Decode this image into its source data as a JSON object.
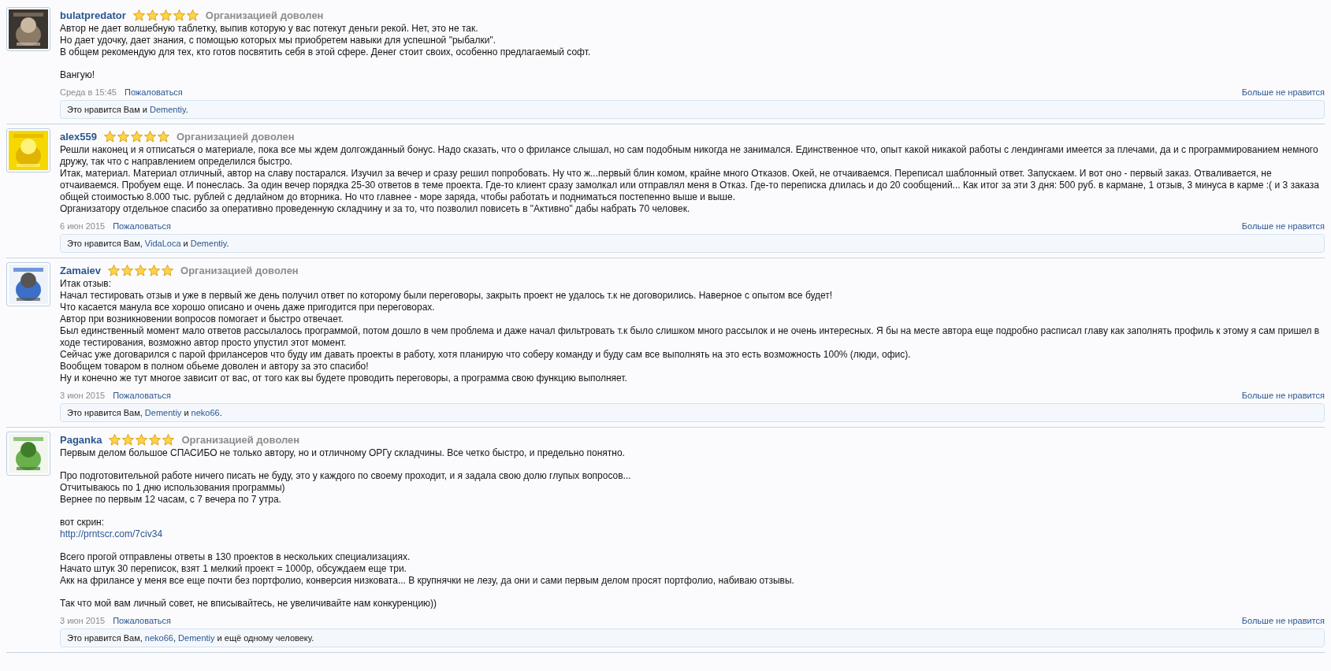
{
  "reviews": [
    {
      "author": "bulatpredator",
      "stars": 5,
      "rating": "Организацией доволен",
      "body": [
        [
          {
            "kind": "text",
            "text": "Автор не дает волшебную таблетку, выпив которую у вас потекут деньги рекой. Нет, это не так."
          },
          {
            "kind": "text",
            "text": "Но дает удочку, дает знания, с помощью которых мы приобретем навыки для успешной \"рыбалки\"."
          },
          {
            "kind": "text",
            "text": "В общем рекомендую для тех, кто готов посвятить себя в этой сфере. Денег стоит своих, особенно предлагаемый софт."
          }
        ],
        [
          {
            "kind": "text",
            "text": "Вангую!"
          }
        ]
      ],
      "date": "Среда в 15:45",
      "report": "Пожаловаться",
      "unlike": "Больше не нравится",
      "likes": [
        {
          "kind": "text",
          "text": "Это нравится Вам и "
        },
        {
          "kind": "user",
          "text": "Dementiy"
        },
        {
          "kind": "text",
          "text": "."
        }
      ]
    },
    {
      "author": "alex559",
      "stars": 5,
      "rating": "Организацией доволен",
      "body": [
        [
          {
            "kind": "text",
            "text": "Решли наконец и я отписаться о материале, пока все мы ждем долгожданный бонус. Надо сказать, что о фрилансе слышал, но сам подобным никогда не занимался. Единственное что, опыт какой никакой работы с лендингами имеется за плечами, да и с программированием немного дружу, так что с направлением определился быстро."
          },
          {
            "kind": "text",
            "text": "Итак, материал. Материал отличный, автор на славу постарался. Изучил за вечер и сразу решил попробовать. Ну что ж...первый блин комом, крайне много Отказов. Окей, не отчаиваемся. Переписал шаблонный ответ. Запускаем. И вот оно - первый заказ. Отваливается, не отчаиваемся. Пробуем еще. И понеслась. За один вечер порядка 25-30 ответов в теме проекта. Где-то клиент сразу замолкал или отправлял меня в Отказ. Где-то переписка длилась и до 20 сообщений... Как итог за эти 3 дня: 500 руб. в кармане, 1 отзыв, 3 минуса в карме :( и 3 заказа общей стоимостью 8.000 тыс. рублей с дедлайном до вторника. Но что главнее - море заряда, чтобы работать и подниматься постепенно выше и выше."
          },
          {
            "kind": "text",
            "text": "Организатору отдельное спасибо за оперативно проведенную складчину и за то, что позволил повисеть в \"Активно\" дабы набрать 70 человек."
          }
        ]
      ],
      "date": "6 июн 2015",
      "report": "Пожаловаться",
      "unlike": "Больше не нравится",
      "likes": [
        {
          "kind": "text",
          "text": "Это нравится Вам, "
        },
        {
          "kind": "user",
          "text": "VidaLoca"
        },
        {
          "kind": "text",
          "text": " и "
        },
        {
          "kind": "user",
          "text": "Dementiy"
        },
        {
          "kind": "text",
          "text": "."
        }
      ]
    },
    {
      "author": "Zamaiev",
      "stars": 5,
      "rating": "Организацией доволен",
      "body": [
        [
          {
            "kind": "text",
            "text": "Итак отзыв:"
          },
          {
            "kind": "text",
            "text": "Начал тестировать отзыв и уже в первый же день получил ответ по которому были переговоры, закрыть проект не удалось т.к не договорились. Наверное с опытом все будет!"
          },
          {
            "kind": "text",
            "text": "Что касается манула все хорошо описано и очень даже пригодится при переговорах."
          },
          {
            "kind": "text",
            "text": "Автор при возникновении вопросов помогает и быстро отвечает."
          },
          {
            "kind": "text",
            "text": "Был единственный момент мало ответов рассылалось программой, потом дошло в чем проблема и даже начал фильтровать т.к было слишком много рассылок и не очень интересных. Я бы на месте автора еще подробно расписал главу как заполнять профиль к этому я сам пришел в ходе тестирования, возможно автор просто упустил этот момент."
          },
          {
            "kind": "text",
            "text": "Сейчас уже договарился с парой фрилансеров что буду им давать проекты в работу, хотя планирую что соберу команду и буду сам все выполнять на это есть возможность 100% (люди, офис)."
          },
          {
            "kind": "text",
            "text": "Вообщем товаром в полном обьеме доволен и автору за это спасибо!"
          },
          {
            "kind": "text",
            "text": "Ну и конечно же тут многое зависит от вас, от того как вы будете проводить переговоры, а программа свою функцию выполняет."
          }
        ]
      ],
      "date": "3 июн 2015",
      "report": "Пожаловаться",
      "unlike": "Больше не нравится",
      "likes": [
        {
          "kind": "text",
          "text": "Это нравится Вам, "
        },
        {
          "kind": "user",
          "text": "Dementiy"
        },
        {
          "kind": "text",
          "text": " и "
        },
        {
          "kind": "user",
          "text": "neko66"
        },
        {
          "kind": "text",
          "text": "."
        }
      ]
    },
    {
      "author": "Paganka",
      "stars": 5,
      "rating": "Организацией доволен",
      "body": [
        [
          {
            "kind": "text",
            "text": "Первым делом большое СПАСИБО не только автору, но и отличному ОРГу складчины. Все четко быстро, и предельно понятно."
          }
        ],
        [
          {
            "kind": "text",
            "text": "Про подготовительной работе ничего писать не буду, это у каждого по своему проходит, и я задала свою долю глупых вопросов..."
          },
          {
            "kind": "text",
            "text": "Отчитываюсь по 1 дню использования программы)"
          },
          {
            "kind": "text",
            "text": "Вернее по первым 12 часам, с 7 вечера по 7 утра."
          }
        ],
        [
          {
            "kind": "text",
            "text": "вот скрин:"
          },
          {
            "kind": "link",
            "text": "http://prntscr.com/7civ34"
          }
        ],
        [
          {
            "kind": "text",
            "text": "Всего прогой отправлены ответы в 130 проектов в нескольких специализациях."
          },
          {
            "kind": "text",
            "text": "Начато штук 30 переписок, взят 1 мелкий проект = 1000р, обсуждаем еще три."
          },
          {
            "kind": "text",
            "text": "Акк на фрилансе у меня все еще почти без портфолио, конверсия низковата... В крупнячки не лезу, да они и сами первым делом просят портфолио, набиваю отзывы."
          }
        ],
        [
          {
            "kind": "text",
            "text": "Так что мой вам личный совет, не вписывайтесь, не увеличивайте нам конкуренцию))"
          }
        ]
      ],
      "date": "3 июн 2015",
      "report": "Пожаловаться",
      "unlike": "Больше не нравится",
      "likes": [
        {
          "kind": "text",
          "text": "Это нравится Вам, "
        },
        {
          "kind": "user",
          "text": "neko66"
        },
        {
          "kind": "text",
          "text": ", "
        },
        {
          "kind": "user",
          "text": "Dementiy"
        },
        {
          "kind": "text",
          "text": " и ещё одному человеку"
        },
        {
          "kind": "text",
          "text": "."
        }
      ]
    }
  ]
}
